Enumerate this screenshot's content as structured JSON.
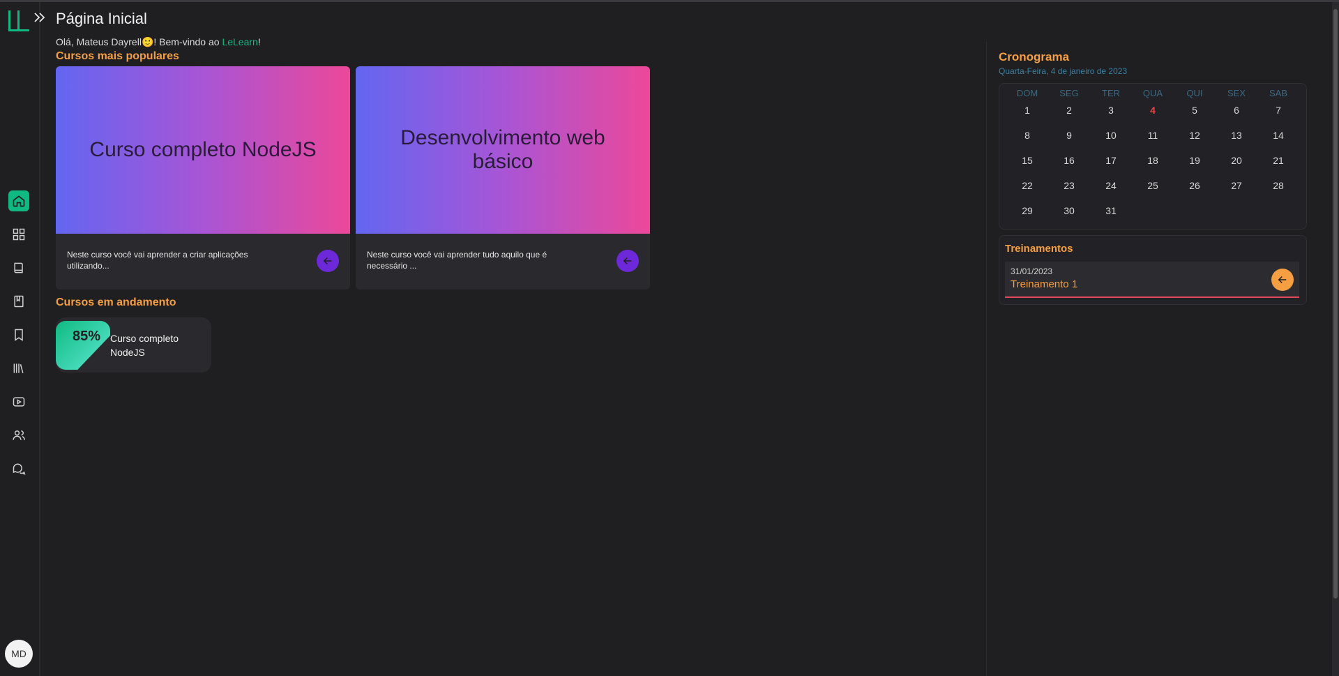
{
  "header": {
    "title": "Página Inicial"
  },
  "welcome": {
    "prefix": "Olá, Mateus Dayrell",
    "emoji": "🙂",
    "middle": "! Bem-vindo ao ",
    "brand": "LeLearn",
    "suffix": "!"
  },
  "popular": {
    "title": "Cursos mais populares",
    "courses": [
      {
        "name": "Curso completo NodeJS",
        "description": "Neste curso você vai aprender a criar aplicações utilizando..."
      },
      {
        "name": "Desenvolvimento web básico",
        "description": "Neste curso você vai aprender tudo aquilo que é necessário ..."
      }
    ]
  },
  "in_progress": {
    "title": "Cursos em andamento",
    "items": [
      {
        "percent": "85%",
        "name": "Curso completo NodeJS"
      }
    ]
  },
  "schedule": {
    "title": "Cronograma",
    "subtitle": "Quarta-Feira, 4 de janeiro de 2023",
    "weekdays": [
      "DOM",
      "SEG",
      "TER",
      "QUA",
      "QUI",
      "SEX",
      "SAB"
    ],
    "today": "4",
    "days": [
      "1",
      "2",
      "3",
      "4",
      "5",
      "6",
      "7",
      "8",
      "9",
      "10",
      "11",
      "12",
      "13",
      "14",
      "15",
      "16",
      "17",
      "18",
      "19",
      "20",
      "21",
      "22",
      "23",
      "24",
      "25",
      "26",
      "27",
      "28",
      "29",
      "30",
      "31"
    ]
  },
  "trainings": {
    "title": "Treinamentos",
    "items": [
      {
        "date": "31/01/2023",
        "name": "Treinamento 1"
      }
    ]
  },
  "user": {
    "initials": "MD"
  },
  "sidebar": {
    "icons": [
      "home-icon",
      "grid-icon",
      "book-open-icon",
      "book-icon",
      "bookmark-icon",
      "library-icon",
      "video-icon",
      "users-icon",
      "chat-icon"
    ]
  },
  "colors": {
    "accent": "#10b981",
    "orange": "#f59e42",
    "purple": "#6d28d9",
    "today": "#ef4444"
  }
}
